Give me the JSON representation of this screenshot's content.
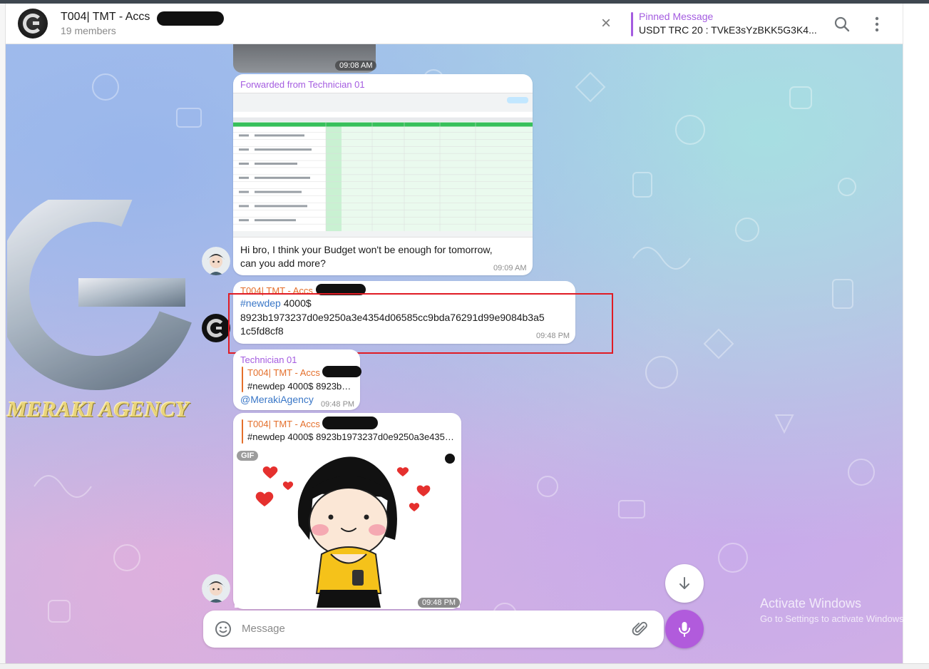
{
  "header": {
    "title": "T004| TMT - Accs",
    "members": "19 members",
    "pinned_label": "Pinned Message",
    "pinned_text": "USDT TRC 20 : TVkE3sYzBKK5G3K4..."
  },
  "watermark": {
    "text": "MERAKI AGENCY"
  },
  "messages": [
    {
      "time": "09:08 AM"
    },
    {
      "forwarded_from": "Forwarded from Technician 01",
      "text_line1": "Hi bro, I think your Budget won't be enough for tomorrow,",
      "text_line2": "can you add more?",
      "time": "09:09 AM"
    },
    {
      "sender": "T004| TMT - Accs",
      "hashtag": "#newdep",
      "amount": " 4000$",
      "hash_line1": "8923b1973237d0e9250a3e4354d06585cc9bda76291d99e9084b3a5",
      "hash_line2": "1c5fd8cf8",
      "time": "09:48 PM"
    },
    {
      "sender": "Technician 01",
      "reply_sender": "T004| TMT - Accs",
      "reply_text": "#newdep 4000$ 8923b…",
      "mention": "@MerakiAgency",
      "time": "09:48 PM"
    },
    {
      "reply_sender": "T004| TMT - Accs",
      "reply_text": "#newdep 4000$ 8923b1973237d0e9250a3e435…",
      "gif_badge": "GIF",
      "time": "09:48 PM"
    }
  ],
  "composer": {
    "placeholder": "Message"
  },
  "os_watermark": {
    "line1": "Activate Windows",
    "line2": "Go to Settings to activate Windows."
  },
  "colors": {
    "accent": "#a45ce0",
    "reply_accent": "#e46f2b",
    "link": "#3a77c7",
    "highlight_box": "#e01b24",
    "mic_button": "#b15bdc"
  }
}
